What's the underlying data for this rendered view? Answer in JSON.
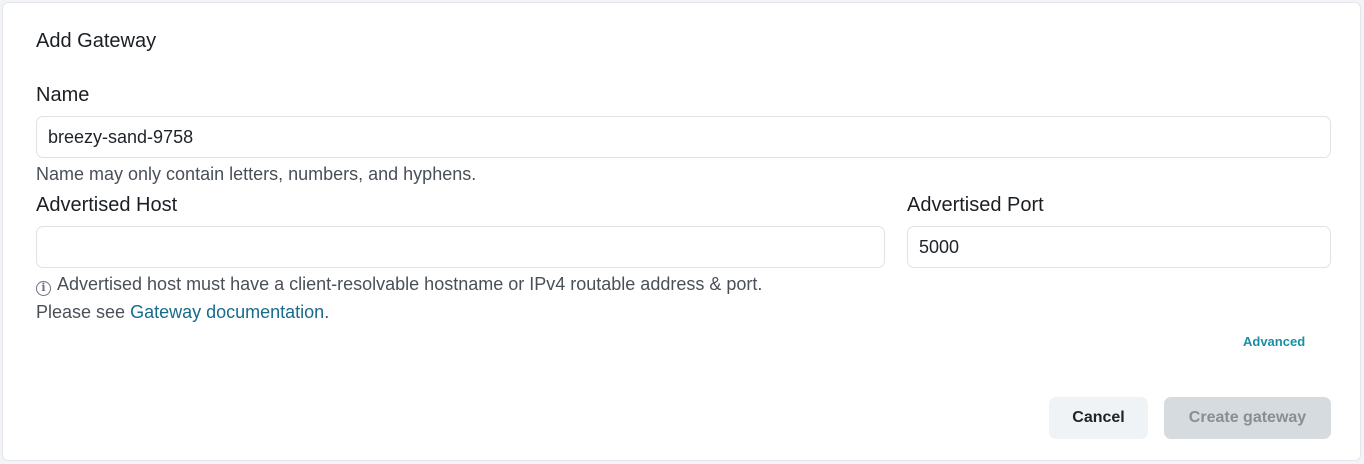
{
  "dialog": {
    "title": "Add Gateway"
  },
  "name_field": {
    "label": "Name",
    "value": "breezy-sand-9758",
    "hint": "Name may only contain letters, numbers, and hyphens."
  },
  "host_field": {
    "label": "Advertised Host",
    "value": "",
    "placeholder": "",
    "hint": "Advertised host must have a client-resolvable hostname or IPv4 routable address & port.",
    "see_prefix": "Please see ",
    "doc_link": "Gateway documentation",
    "see_suffix": "."
  },
  "port_field": {
    "label": "Advertised Port",
    "value": "5000"
  },
  "advanced_link": "Advanced",
  "actions": {
    "cancel": "Cancel",
    "create": "Create gateway"
  },
  "icons": {
    "info": "info-icon"
  }
}
